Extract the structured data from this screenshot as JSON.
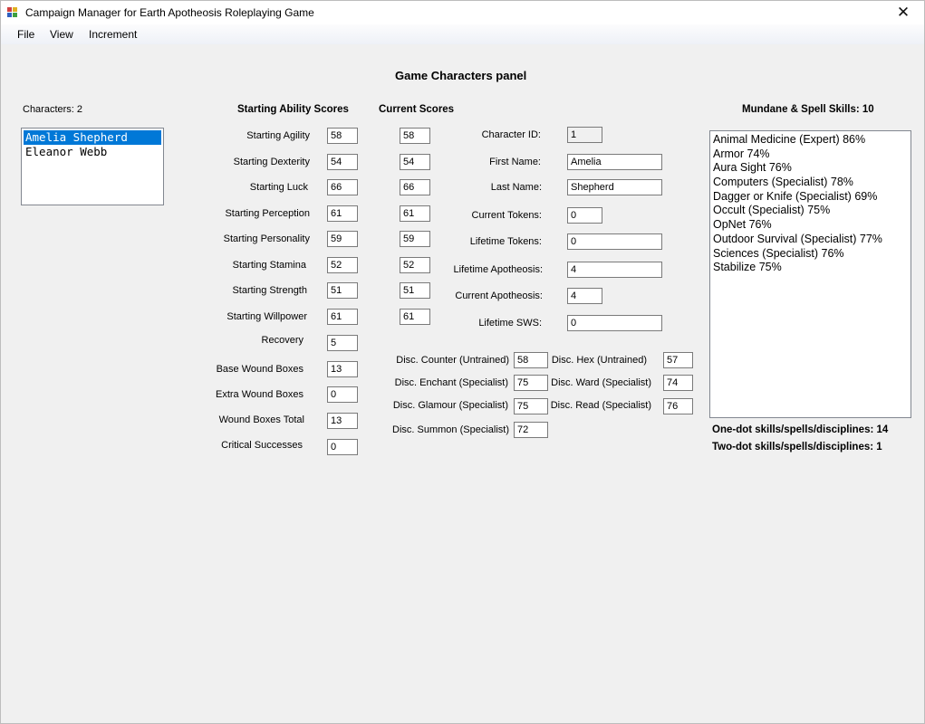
{
  "window": {
    "title": "Campaign Manager for Earth Apotheosis Roleplaying Game",
    "close_glyph": "✕"
  },
  "menu": [
    "File",
    "View",
    "Increment"
  ],
  "panel_title": "Game Characters panel",
  "characters": {
    "count_label": "Characters: 2",
    "items": [
      "Amelia Shepherd",
      "Eleanor Webb"
    ],
    "selected_index": 0
  },
  "headers": {
    "starting": "Starting Ability Scores",
    "current": "Current Scores",
    "skills": "Mundane & Spell Skills: 10"
  },
  "abilities": [
    {
      "label": "Starting Agility",
      "start": "58",
      "current": "58"
    },
    {
      "label": "Starting Dexterity",
      "start": "54",
      "current": "54"
    },
    {
      "label": "Starting Luck",
      "start": "66",
      "current": "66"
    },
    {
      "label": "Starting Perception",
      "start": "61",
      "current": "61"
    },
    {
      "label": "Starting Personality",
      "start": "59",
      "current": "59"
    },
    {
      "label": "Starting Stamina",
      "start": "52",
      "current": "52"
    },
    {
      "label": "Starting Strength",
      "start": "51",
      "current": "51"
    },
    {
      "label": "Starting Willpower",
      "start": "61",
      "current": "61"
    }
  ],
  "extra_stats": [
    {
      "label": "Recovery",
      "value": "5"
    },
    {
      "label": "Base Wound Boxes",
      "value": "13"
    },
    {
      "label": "Extra Wound Boxes",
      "value": "0"
    },
    {
      "label": "Wound Boxes Total",
      "value": "13"
    },
    {
      "label": "Critical Successes",
      "value": "0"
    }
  ],
  "character_info": [
    {
      "label": "Character ID:",
      "value": "1"
    },
    {
      "label": "First Name:",
      "value": "Amelia"
    },
    {
      "label": "Last Name:",
      "value": "Shepherd"
    },
    {
      "label": "Current Tokens:",
      "value": "0"
    },
    {
      "label": "Lifetime Tokens:",
      "value": "0"
    },
    {
      "label": "Lifetime Apotheosis:",
      "value": "4"
    },
    {
      "label": "Current Apotheosis:",
      "value": "4"
    },
    {
      "label": "Lifetime SWS:",
      "value": "0"
    }
  ],
  "disciplines_left": [
    {
      "label": "Disc. Counter (Untrained)",
      "value": "58"
    },
    {
      "label": "Disc. Enchant (Specialist)",
      "value": "75"
    },
    {
      "label": "Disc. Glamour (Specialist)",
      "value": "75"
    },
    {
      "label": "Disc. Summon (Specialist)",
      "value": "72"
    }
  ],
  "disciplines_right": [
    {
      "label": "Disc. Hex (Untrained)",
      "value": "57"
    },
    {
      "label": "Disc. Ward (Specialist)",
      "value": "74"
    },
    {
      "label": "Disc. Read (Specialist)",
      "value": "76"
    }
  ],
  "skills": [
    "Animal Medicine (Expert) 86%",
    "Armor 74%",
    "Aura Sight 76%",
    "Computers (Specialist) 78%",
    "Dagger or Knife (Specialist) 69%",
    "Occult (Specialist) 75%",
    "OpNet 76%",
    "Outdoor Survival (Specialist) 77%",
    "Sciences (Specialist) 76%",
    "Stabilize 75%"
  ],
  "summary": {
    "one_dot": "One-dot skills/spells/disciplines: 14",
    "two_dot": "Two-dot skills/spells/disciplines: 1"
  },
  "colors": {
    "selection": "#0078d7",
    "window_bg": "#f0f0f0"
  }
}
